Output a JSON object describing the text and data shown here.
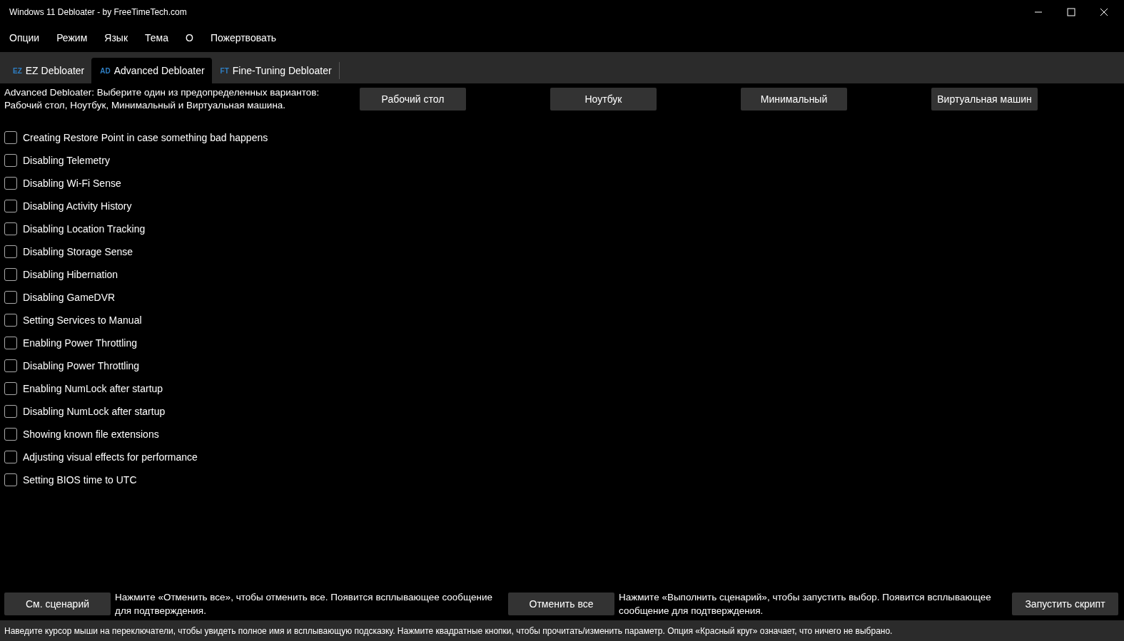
{
  "window": {
    "title": "Windows 11 Debloater - by FreeTimeTech.com"
  },
  "menu": [
    "Опции",
    "Режим",
    "Язык",
    "Тема",
    "О",
    "Пожертвовать"
  ],
  "tabs": [
    {
      "badge": "EZ",
      "label": "EZ Debloater",
      "selected": false
    },
    {
      "badge": "AD",
      "label": "Advanced Debloater",
      "selected": true
    },
    {
      "badge": "FT",
      "label": "Fine-Tuning Debloater",
      "selected": false
    }
  ],
  "description": "Advanced Debloater: Выберите один из предопределенных вариантов: Рабочий стол, Ноутбук, Минимальный и Виртуальная машина.",
  "presets": [
    "Рабочий стол",
    "Ноутбук",
    "Минимальный",
    "Виртуальная машин"
  ],
  "options": [
    {
      "label": "Creating Restore Point in case something bad happens",
      "checked": false
    },
    {
      "label": "Disabling Telemetry",
      "checked": false
    },
    {
      "label": "Disabling Wi-Fi Sense",
      "checked": false
    },
    {
      "label": "Disabling Activity History",
      "checked": false
    },
    {
      "label": "Disabling Location Tracking",
      "checked": false
    },
    {
      "label": "Disabling Storage Sense",
      "checked": false
    },
    {
      "label": "Disabling Hibernation",
      "checked": false
    },
    {
      "label": "Disabling GameDVR",
      "checked": false
    },
    {
      "label": "Setting Services to Manual",
      "checked": false
    },
    {
      "label": "Enabling Power Throttling",
      "checked": false
    },
    {
      "label": "Disabling Power Throttling",
      "checked": false
    },
    {
      "label": "Enabling NumLock after startup",
      "checked": false
    },
    {
      "label": "Disabling NumLock after startup",
      "checked": false
    },
    {
      "label": "Showing known file extensions",
      "checked": false
    },
    {
      "label": "Adjusting visual effects for performance",
      "checked": false
    },
    {
      "label": "Setting BIOS time to UTC",
      "checked": false
    }
  ],
  "footer": [
    {
      "button": "См. сценарий",
      "hint": "Нажмите «Отменить все», чтобы отменить все. Появится всплывающее сообщение для подтверждения."
    },
    {
      "button": "Отменить все",
      "hint": "Нажмите «Выполнить сценарий», чтобы запустить выбор. Появится всплывающее сообщение для подтверждения."
    },
    {
      "button": "Запустить скрипт"
    }
  ],
  "status_bar": "Наведите курсор мыши на переключатели, чтобы увидеть полное имя и всплывающую подсказку. Нажмите квадратные кнопки, чтобы прочитать/изменить параметр. Опция «Красный круг» означает, что ничего не выбрано."
}
